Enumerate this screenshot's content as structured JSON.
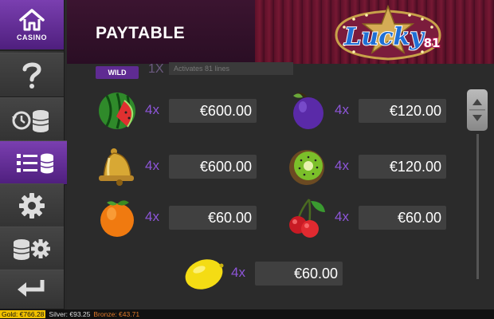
{
  "sidebar": {
    "casino_label": "CASINO",
    "items": [
      {
        "name": "help",
        "icon": "question-icon"
      },
      {
        "name": "history",
        "icon": "history-coins-icon"
      },
      {
        "name": "paytable",
        "icon": "paytable-list-icon",
        "active": true
      },
      {
        "name": "settings",
        "icon": "gear-icon"
      },
      {
        "name": "bet-settings",
        "icon": "coins-gear-icon"
      },
      {
        "name": "back",
        "icon": "back-arrow-icon"
      }
    ]
  },
  "header": {
    "title": "PAYTABLE",
    "logo_text": "Lucky",
    "logo_number": "81"
  },
  "wild_row": {
    "badge": "WILD",
    "multiplier": "1X",
    "description": "Activates 81 lines"
  },
  "paytable": [
    {
      "symbol": "watermelon",
      "multiplier": "4x",
      "value": "€600.00"
    },
    {
      "symbol": "plum",
      "multiplier": "4x",
      "value": "€120.00"
    },
    {
      "symbol": "bell",
      "multiplier": "4x",
      "value": "€600.00"
    },
    {
      "symbol": "kiwi",
      "multiplier": "4x",
      "value": "€120.00"
    },
    {
      "symbol": "orange",
      "multiplier": "4x",
      "value": "€60.00"
    },
    {
      "symbol": "cherries",
      "multiplier": "4x",
      "value": "€60.00"
    },
    {
      "symbol": "lemon",
      "multiplier": "4x",
      "value": "€60.00"
    }
  ],
  "footer": {
    "gold": "Gold: €766.28",
    "silver": "Silver: €93.25",
    "bronze": "Bronze: €43.71"
  },
  "colors": {
    "accent_purple": "#7a3fb0",
    "multiplier_purple": "#8d55d8",
    "gold": "#f2c200",
    "silver": "#dddddd",
    "bronze": "#e07a2a"
  }
}
